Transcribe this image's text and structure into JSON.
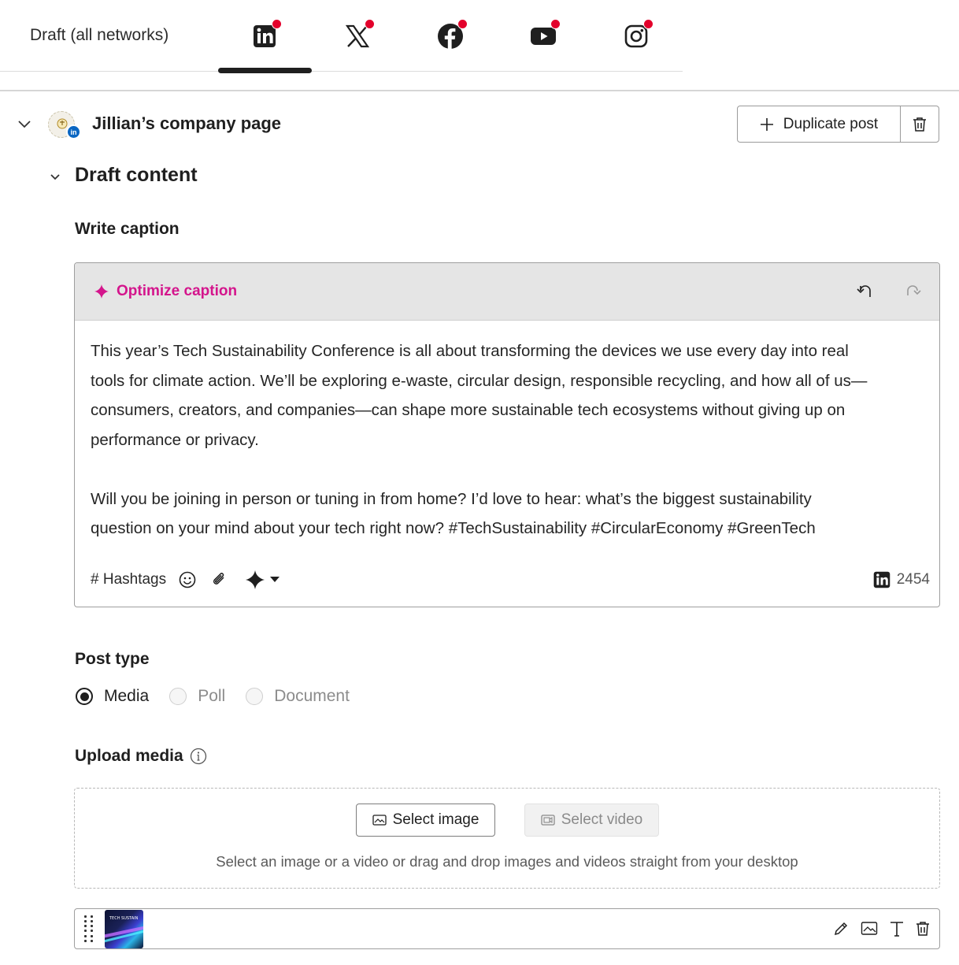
{
  "tabs": {
    "draft_label": "Draft (all networks)",
    "networks": [
      {
        "name": "LinkedIn",
        "icon": "linkedin-icon",
        "active": true
      },
      {
        "name": "X",
        "icon": "x-icon",
        "active": false
      },
      {
        "name": "Facebook",
        "icon": "facebook-icon",
        "active": false
      },
      {
        "name": "YouTube",
        "icon": "youtube-icon",
        "active": false
      },
      {
        "name": "Instagram",
        "icon": "instagram-icon",
        "active": false
      }
    ],
    "alert_color": "#e3002b"
  },
  "account": {
    "name": "Jillian’s company page",
    "badge": "in",
    "duplicate_label": "Duplicate post"
  },
  "draft": {
    "title": "Draft content",
    "caption_label": "Write caption",
    "optimize_label": "Optimize caption",
    "caption_text": "This year’s Tech Sustainability Conference is all about transforming the devices we use every day into real\ntools for climate action. We’ll be exploring e-waste, circular design, responsible recycling, and how all of us—\nconsumers, creators, and companies—can shape more sustainable tech ecosystems without giving up on\nperformance or privacy.\n\nWill you be joining in person or tuning in from home? I’d love to hear: what’s the biggest sustainability\nquestion on your mind about your tech right now? #TechSustainability #CircularEconomy #GreenTech",
    "hashtags_label": "# Hashtags",
    "char_count": "2454",
    "accent_color": "#d4158c"
  },
  "post_type": {
    "label": "Post type",
    "options": [
      {
        "label": "Media",
        "selected": true,
        "disabled": false
      },
      {
        "label": "Poll",
        "selected": false,
        "disabled": true
      },
      {
        "label": "Document",
        "selected": false,
        "disabled": true
      }
    ]
  },
  "upload": {
    "label": "Upload media",
    "select_image": "Select image",
    "select_video": "Select video",
    "hint": "Select an image or a video or drag and drop images and videos straight from your desktop"
  }
}
